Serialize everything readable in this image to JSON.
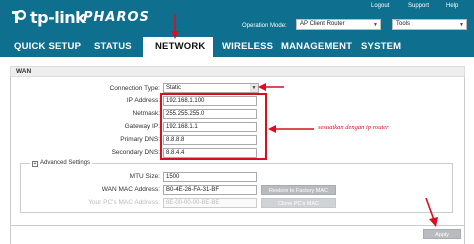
{
  "header": {
    "brand": "tp-link",
    "product": "PHAROS",
    "links": [
      "Logout",
      "Support",
      "Help"
    ],
    "operation_mode_label": "Operation Mode:",
    "operation_mode_value": "AP Client Router",
    "tools_value": "Tools"
  },
  "nav": {
    "tabs": [
      "QUICK SETUP",
      "STATUS",
      "NETWORK",
      "WIRELESS",
      "MANAGEMENT",
      "SYSTEM"
    ],
    "active": "NETWORK"
  },
  "section": {
    "title": "WAN"
  },
  "form": {
    "connection_type": {
      "label": "Connection Type:",
      "value": "Static"
    },
    "ip_address": {
      "label": "IP Address:",
      "value": "192.168.1.100"
    },
    "netmask": {
      "label": "Netmask:",
      "value": "255.255.255.0"
    },
    "gateway_ip": {
      "label": "Gateway IP:",
      "value": "192.168.1.1"
    },
    "primary_dns": {
      "label": "Primary DNS:",
      "value": "8.8.8.8"
    },
    "secondary_dns": {
      "label": "Secondary DNS:",
      "value": "8.8.4.4"
    }
  },
  "annotation": {
    "text": "sesuaikan dengan ip router"
  },
  "advanced": {
    "legend": "Advanced Settings",
    "toggle_symbol": "+",
    "mtu": {
      "label": "MTU Size:",
      "value": "1500"
    },
    "wan_mac": {
      "label": "WAN MAC Address:",
      "value": "B0-4E-26-FA-31-BF"
    },
    "pc_mac": {
      "label": "Your PC's MAC Address:",
      "value": "8E-00-00-00-BE-BE"
    },
    "restore_mac_button": "Restore to Factory MAC",
    "clone_mac_button": "Clone PC's MAC"
  },
  "apply_button": "Apply",
  "colors": {
    "header_bg": "#0f6f8e",
    "annotation_red": "#d6101f",
    "button_gray": "#b8bcc0"
  },
  "icons": {
    "logo": "tp-link-logo-icon",
    "select_arrow": "chevron-down-icon"
  }
}
